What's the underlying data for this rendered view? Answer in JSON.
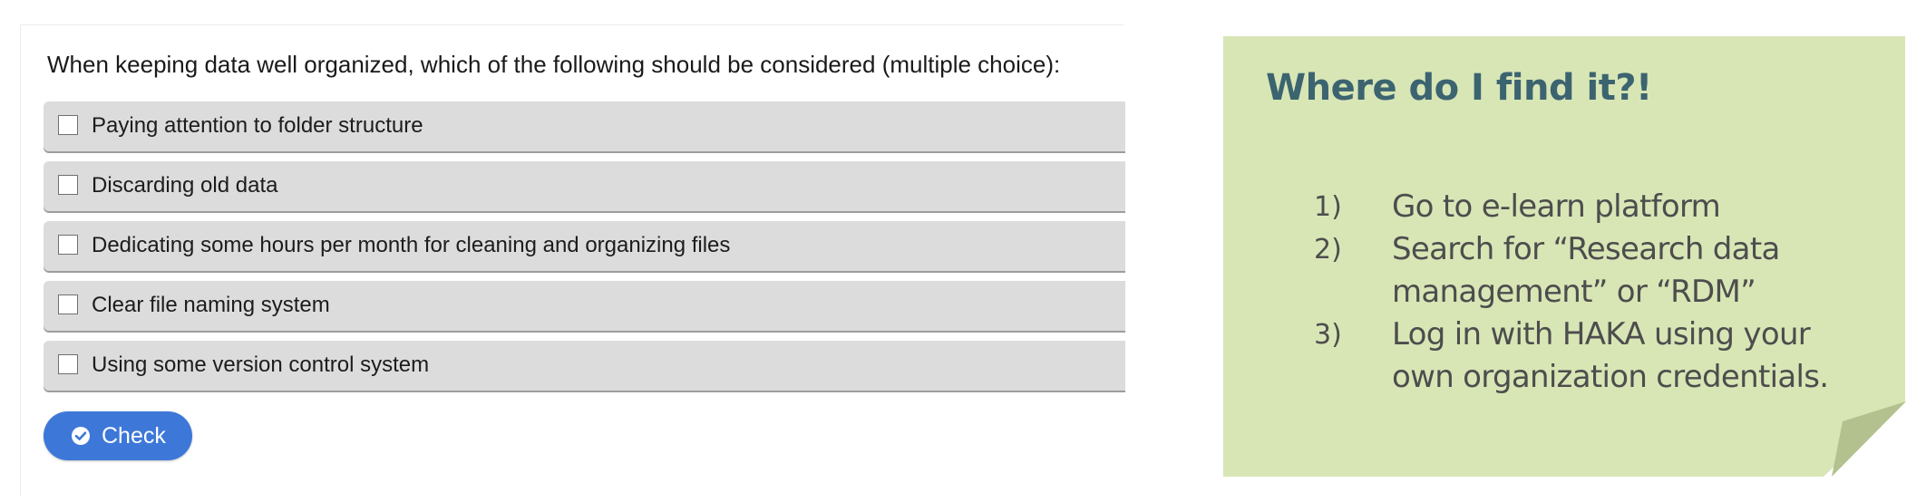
{
  "quiz": {
    "question": "When keeping data well organized, which of the following should be considered (multiple choice):",
    "options": [
      {
        "label": "Paying attention to folder structure",
        "checked": false
      },
      {
        "label": "Discarding old data",
        "checked": false
      },
      {
        "label": "Dedicating some hours per month for cleaning and organizing files",
        "checked": false
      },
      {
        "label": "Clear file naming system",
        "checked": false
      },
      {
        "label": "Using some version control system",
        "checked": false
      }
    ],
    "check_button": {
      "label": "Check",
      "icon": "check-circle-icon",
      "color": "#3d78d8"
    }
  },
  "note": {
    "title": "Where do I find it?!",
    "background_color": "#d8e6b6",
    "title_color": "#3c6470",
    "steps": [
      {
        "number": "1)",
        "text": "Go to e-learn platform"
      },
      {
        "number": "2)",
        "text": "Search for “Research data management” or “RDM”"
      },
      {
        "number": "3)",
        "text": "Log in with HAKA using your own organization credentials."
      }
    ]
  }
}
